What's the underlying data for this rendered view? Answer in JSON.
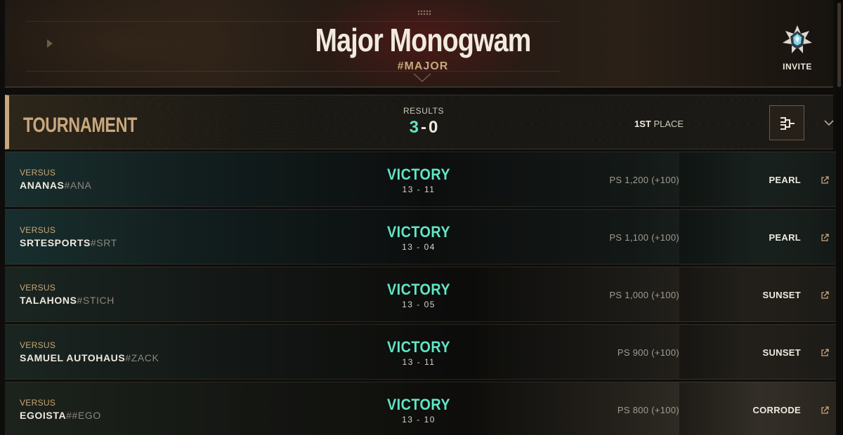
{
  "header": {
    "title": "Major Monogwam",
    "tag": "#MAJOR",
    "invite_label": "INVITE"
  },
  "tournament": {
    "label": "TOURNAMENT",
    "results_label": "RESULTS",
    "wins": "3",
    "losses": "0",
    "place_rank": "1ST",
    "place_suffix": "PLACE"
  },
  "matches": [
    {
      "versus": "VERSUS",
      "name": "ANANAS",
      "tag": "#ANA",
      "result": "VICTORY",
      "score": "13 - 11",
      "ps": "PS 1,200 (+100)",
      "map": "PEARL"
    },
    {
      "versus": "VERSUS",
      "name": "SRTESPORTS",
      "tag": "#SRT",
      "result": "VICTORY",
      "score": "13 - 04",
      "ps": "PS 1,100 (+100)",
      "map": "PEARL"
    },
    {
      "versus": "VERSUS",
      "name": "TALAHONS",
      "tag": "#STICH",
      "result": "VICTORY",
      "score": "13 - 05",
      "ps": "PS 1,000 (+100)",
      "map": "SUNSET"
    },
    {
      "versus": "VERSUS",
      "name": "SAMUEL AUTOHAUS",
      "tag": "#ZACK",
      "result": "VICTORY",
      "score": "13 - 11",
      "ps": "PS 900 (+100)",
      "map": "SUNSET"
    },
    {
      "versus": "VERSUS",
      "name": "EGOISTA",
      "tag": "##EGO",
      "result": "VICTORY",
      "score": "13 - 10",
      "ps": "PS 800 (+100)",
      "map": "CORRODE"
    }
  ],
  "colors": {
    "victory": "#5fe6c4",
    "gold": "#c9a77d",
    "tag_gold": "#c8a878"
  },
  "icons": {
    "invite": "radiant-rank-icon",
    "bracket": "bracket-icon",
    "expand": "chevron-down-icon",
    "open_match": "external-link-icon"
  }
}
